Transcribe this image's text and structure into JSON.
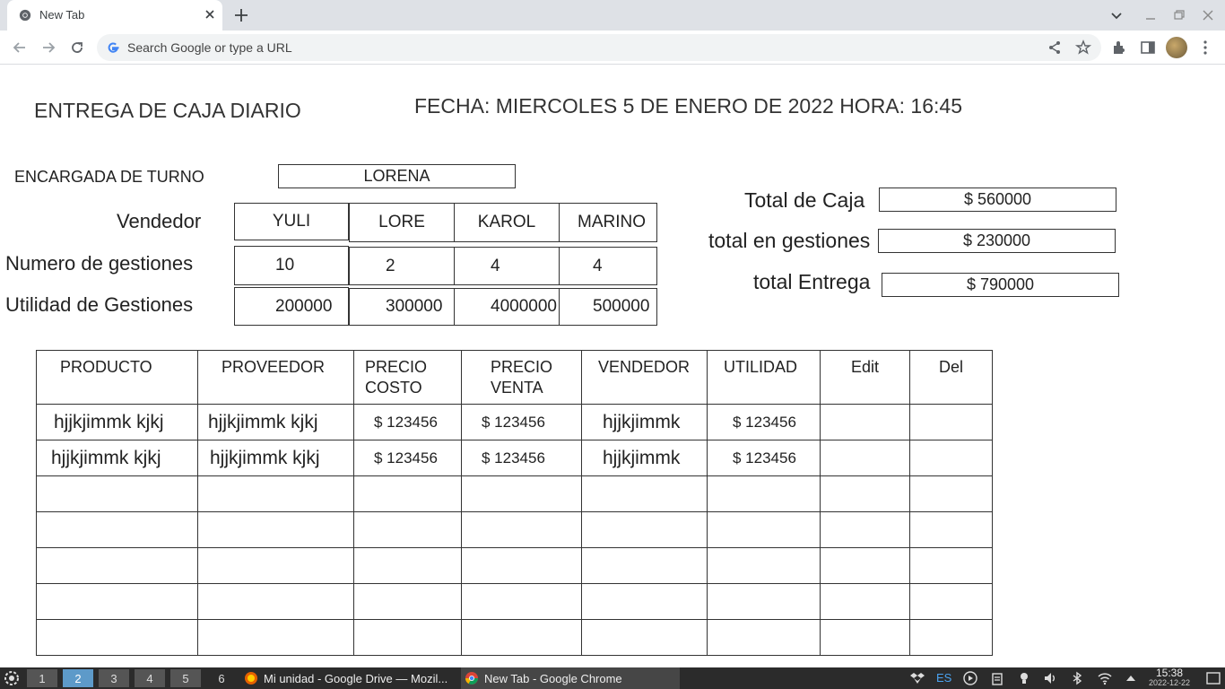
{
  "browser": {
    "tab_title": "New Tab",
    "omnibox_placeholder": "Search Google or type a URL"
  },
  "page": {
    "title": "ENTREGA DE CAJA DIARIO",
    "fecha": "FECHA:  MIERCOLES 5 DE ENERO DE 2022 HORA: 16:45",
    "encargada_label": "ENCARGADA DE TURNO",
    "encargada_value": "LORENA",
    "vendedor_label": "Vendedor",
    "gestiones_label": "Numero de gestiones",
    "utilidad_label": "Utilidad de Gestiones",
    "vendedores": [
      "YULI",
      "LORE",
      "KAROL",
      "MARINO"
    ],
    "gestiones": [
      "10",
      "2",
      "4",
      "4"
    ],
    "utilidades": [
      "200000",
      "300000",
      "4000000",
      "500000"
    ],
    "totals": {
      "caja_label": "Total de Caja",
      "caja_value": "$ 560000",
      "gestiones_label": "total en gestiones",
      "gestiones_value": "$ 230000",
      "entrega_label": "total Entrega",
      "entrega_value": "$ 790000"
    },
    "table": {
      "headers": [
        "PRODUCTO",
        "PROVEEDOR",
        "PRECIO COSTO",
        "PRECIO VENTA",
        "VENDEDOR",
        "UTILIDAD",
        "Edit",
        "Del"
      ],
      "rows": [
        [
          "hjjkjimmk kjkj",
          "hjjkjimmk kjkj",
          "$ 123456",
          "$ 123456",
          "hjjkjimmk",
          "$ 123456",
          "",
          ""
        ],
        [
          "hjjkjimmk kjkj",
          "hjjkjimmk kjkj",
          "$ 123456",
          "$ 123456",
          "hjjkjimmk",
          "$ 123456",
          "",
          ""
        ],
        [
          "",
          "",
          "",
          "",
          "",
          "",
          "",
          ""
        ],
        [
          "",
          "",
          "",
          "",
          "",
          "",
          "",
          ""
        ],
        [
          "",
          "",
          "",
          "",
          "",
          "",
          "",
          ""
        ],
        [
          "",
          "",
          "",
          "",
          "",
          "",
          "",
          ""
        ],
        [
          "",
          "",
          "",
          "",
          "",
          "",
          "",
          ""
        ]
      ]
    }
  },
  "taskbar": {
    "workspaces": [
      "1",
      "2",
      "3",
      "4",
      "5",
      "6"
    ],
    "active_workspace": "2",
    "tasks": [
      "Mi unidad - Google Drive — Mozil...",
      "New Tab - Google Chrome"
    ],
    "lang": "ES",
    "time": "15:38",
    "date": "2022-12-22"
  }
}
